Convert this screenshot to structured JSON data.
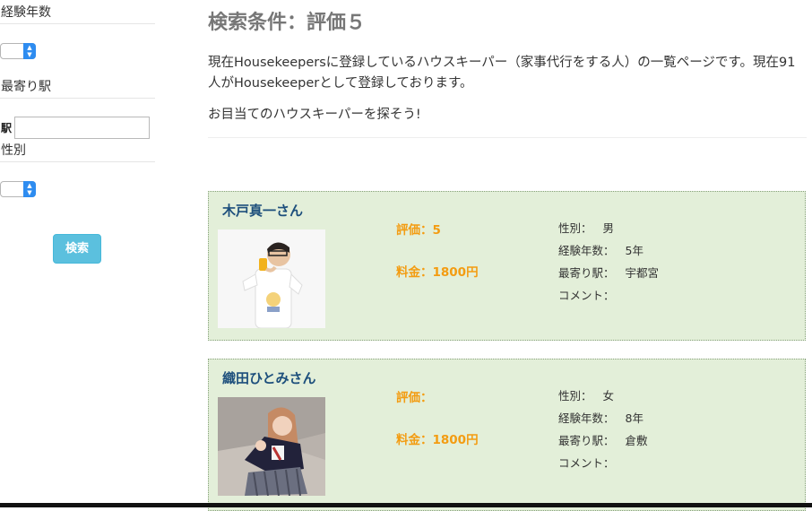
{
  "sidebar": {
    "experience_label": "経験年数",
    "station_label": "最寄り駅",
    "station_field_label": "駅",
    "station_value": "",
    "gender_label": "性別",
    "search_button": "検索"
  },
  "main": {
    "title": "検索条件：評価５",
    "intro_line": "現在Housekeepersに登録しているハウスキーパー（家事代行をする人）の一覧ページです。現在91人がHousekeeperとして登録しております。",
    "tagline": "お目当てのハウスキーパーを探そう!"
  },
  "keepers": [
    {
      "name": "木戸真一さん",
      "rating": "評価：5",
      "price": "料金：1800円",
      "gender_key": "性別：",
      "gender_val": "男",
      "exp_key": "経験年数：",
      "exp_val": "5年",
      "station_key": "最寄り駅：",
      "station_val": "宇都宮",
      "comment_key": "コメント：",
      "comment_val": ""
    },
    {
      "name": "織田ひとみさん",
      "rating": "評価：",
      "price": "料金：1800円",
      "gender_key": "性別：",
      "gender_val": "女",
      "exp_key": "経験年数：",
      "exp_val": "8年",
      "station_key": "最寄り駅：",
      "station_val": "倉敷",
      "comment_key": "コメント：",
      "comment_val": ""
    }
  ],
  "colors": {
    "card_bg": "#e3efd9",
    "name": "#1d4f7c",
    "accent": "#f39c12",
    "button": "#5bc0de"
  }
}
